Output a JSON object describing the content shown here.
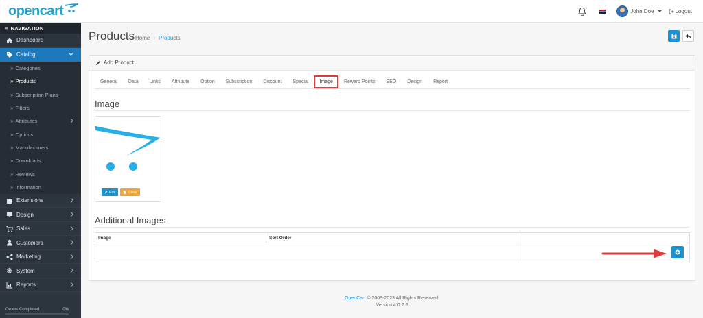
{
  "header": {
    "logo_text": "opencart",
    "user_name": "John Doe",
    "logout_label": "Logout"
  },
  "sidebar": {
    "title": "NAVIGATION",
    "items": [
      {
        "label": "Dashboard",
        "icon": "home-icon"
      },
      {
        "label": "Catalog",
        "icon": "tag-icon",
        "expanded": true
      },
      {
        "label": "Extensions",
        "icon": "puzzle-icon"
      },
      {
        "label": "Design",
        "icon": "monitor-icon"
      },
      {
        "label": "Sales",
        "icon": "cart-icon"
      },
      {
        "label": "Customers",
        "icon": "user-icon"
      },
      {
        "label": "Marketing",
        "icon": "share-icon"
      },
      {
        "label": "System",
        "icon": "gear-icon"
      },
      {
        "label": "Reports",
        "icon": "chart-icon"
      }
    ],
    "catalog_sub": [
      {
        "label": "Categories"
      },
      {
        "label": "Products",
        "active": true
      },
      {
        "label": "Subscription Plans"
      },
      {
        "label": "Filters"
      },
      {
        "label": "Attributes",
        "has_children": true
      },
      {
        "label": "Options"
      },
      {
        "label": "Manufacturers"
      },
      {
        "label": "Downloads"
      },
      {
        "label": "Reviews"
      },
      {
        "label": "Information"
      }
    ],
    "progress": {
      "label": "Orders Completed",
      "value_text": "0%",
      "value": 0
    }
  },
  "page": {
    "title": "Products",
    "breadcrumb": [
      "Home",
      "Products"
    ]
  },
  "card": {
    "title": "Add Product",
    "tabs": [
      "General",
      "Data",
      "Links",
      "Attribute",
      "Option",
      "Subscription",
      "Discount",
      "Special",
      "Image",
      "Reward Points",
      "SEO",
      "Design",
      "Report"
    ],
    "active_tab": "Image",
    "image_section_title": "Image",
    "edit_label": "Edit",
    "clear_label": "Clear",
    "additional_title": "Additional Images",
    "table_headers": [
      "Image",
      "Sort Order"
    ]
  },
  "footer": {
    "link": "OpenCart",
    "copyright": " © 2009-2023 All Rights Reserved.",
    "version": "Version 4.0.2.2"
  },
  "colors": {
    "accent": "#1e91cf",
    "sidebar": "#2c343d",
    "highlight": "#e03a3a",
    "warning": "#f3a638"
  }
}
